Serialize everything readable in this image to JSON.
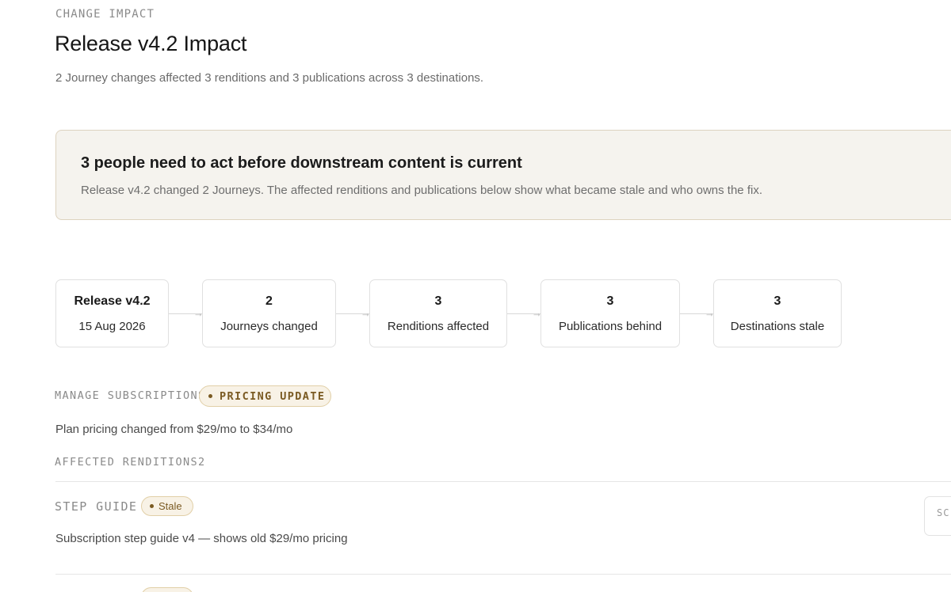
{
  "header": {
    "eyebrow": "CHANGE IMPACT",
    "title": "Release v4.2 Impact",
    "subtitle": "2 Journey changes affected 3 renditions and 3 publications across 3 destinations."
  },
  "callout": {
    "heading": "3 people need to act before downstream content is current",
    "body": "Release v4.2 changed 2 Journeys. The affected renditions and publications below show what became stale and who owns the fix."
  },
  "flow": [
    {
      "value": "Release v4.2",
      "label": "15 Aug 2026"
    },
    {
      "value": "2",
      "label": "Journeys changed"
    },
    {
      "value": "3",
      "label": "Renditions affected"
    },
    {
      "value": "3",
      "label": "Publications behind"
    },
    {
      "value": "3",
      "label": "Destinations stale"
    }
  ],
  "arrow_glyph": "→",
  "journey": {
    "name": "MANAGE SUBSCRIPTIONS",
    "badge": "PRICING UPDATE",
    "change": "Plan pricing changed from $29/mo to $34/mo",
    "renditions_label": "AFFECTED RENDITIONS",
    "renditions_count": "2"
  },
  "renditions": [
    {
      "type": "STEP GUIDE",
      "status": "Stale",
      "description": "Subscription step guide v4 — shows old $29/mo pricing",
      "action": "SC"
    }
  ],
  "colors": {
    "accent_badge_bg": "#f8f2e6",
    "accent_badge_border": "#e1cfa7",
    "accent_badge_text": "#7a5a22",
    "callout_bg": "#f5f3ee",
    "callout_border": "#ddd3bf"
  }
}
